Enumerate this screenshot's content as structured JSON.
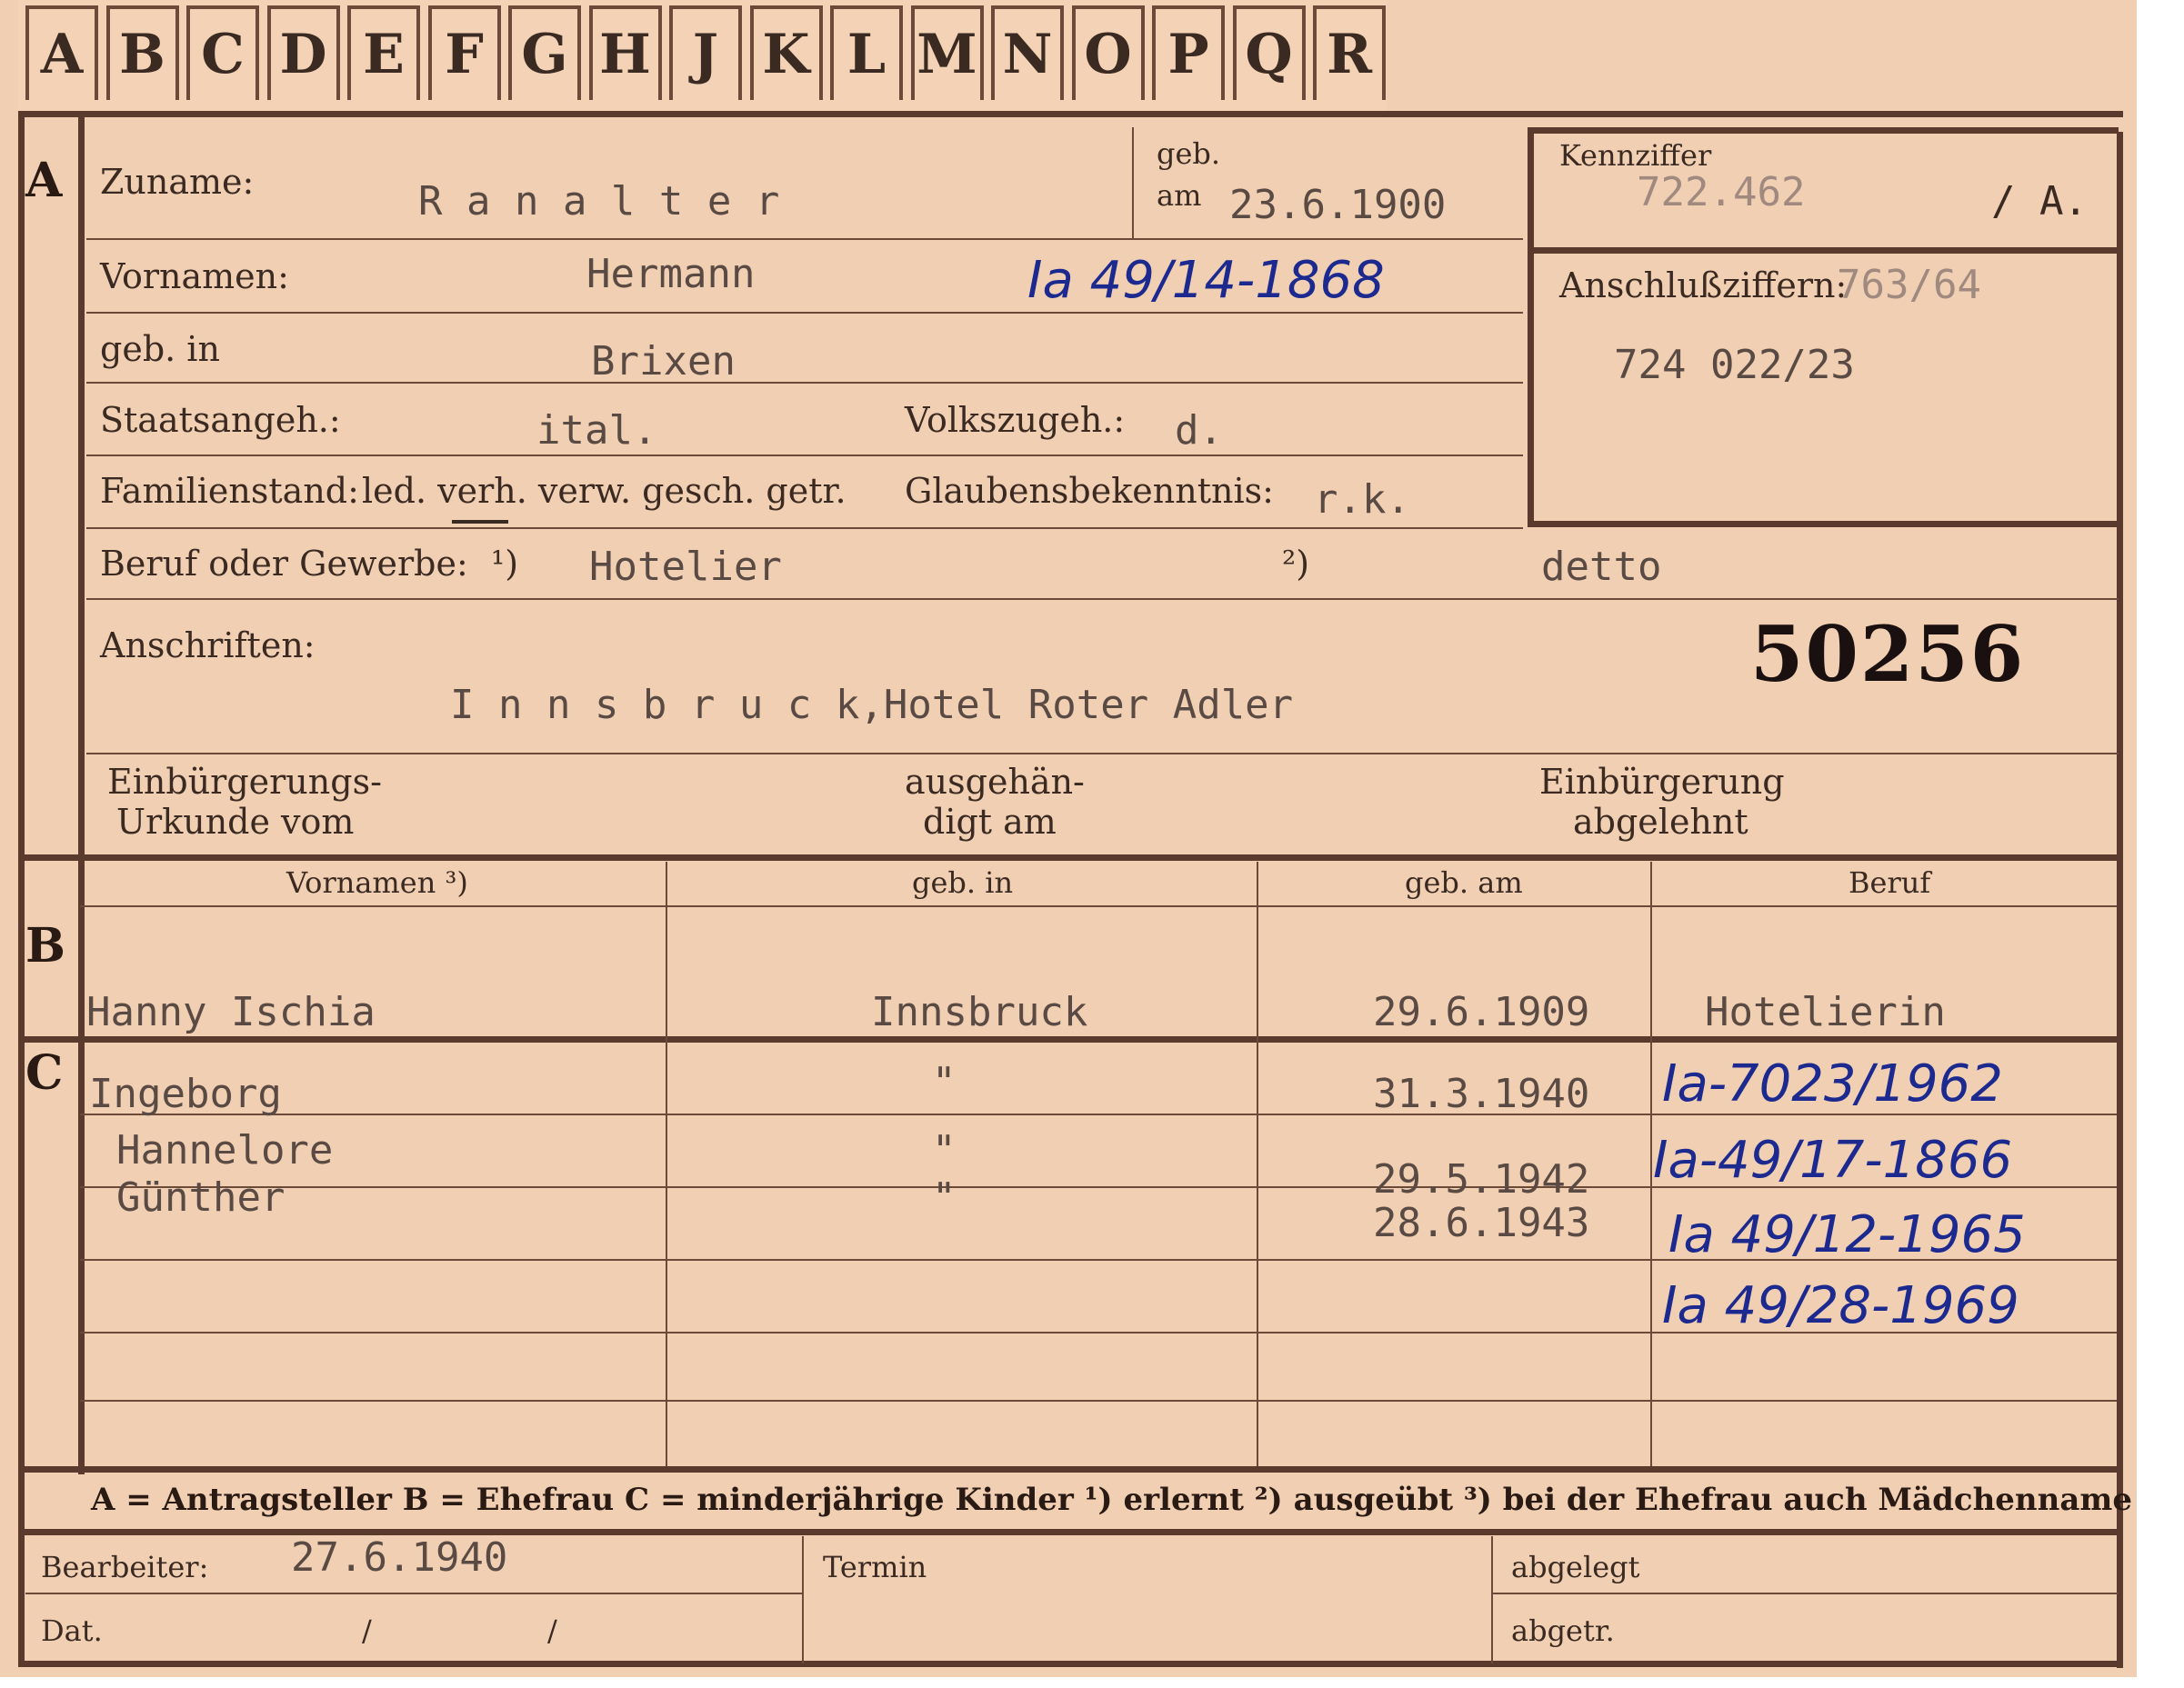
{
  "alphabet_tabs": [
    "A",
    "B",
    "C",
    "D",
    "E",
    "F",
    "G",
    "H",
    "J",
    "K",
    "L",
    "M",
    "N",
    "O",
    "P",
    "Q",
    "R"
  ],
  "sections": {
    "a": "A",
    "b": "B",
    "c": "C"
  },
  "fields": {
    "zuname_label": "Zuname:",
    "zuname_value": "R a n a l t e r",
    "geb_label": "geb.",
    "am_label": "am",
    "geb_am_value": "23.6.1900",
    "kennziffer_label": "Kennziffer",
    "kennziffer_value": "722.462",
    "kennziffer_suffix": "/ A.",
    "vornamen_label": "Vornamen:",
    "vornamen_value": "Hermann",
    "vornamen_hand": "Ia 49/14-1868",
    "anschluss_label": "Anschlußziffern:",
    "anschluss_value1": "763/64",
    "anschluss_value2": "724 022/23",
    "geb_in_label": "geb. in",
    "geb_in_value": "Brixen",
    "staats_label": "Staatsangeh.:",
    "staats_value": "ital.",
    "volks_label": "Volkszugeh.:",
    "volks_value": "d.",
    "familien_label": "Familienstand:",
    "familien_options": "led. verh. verw. gesch. getr.",
    "glaubens_label": "Glaubensbekenntnis:",
    "glaubens_value": "r.k.",
    "beruf_label": "Beruf oder Gewerbe:",
    "beruf_note1": "¹)",
    "beruf_value": "Hotelier",
    "beruf_note2": "²)",
    "beruf_value2": "detto",
    "anschriften_label": "Anschriften:",
    "anschriften_value": "I n n s b r u c k,Hotel Roter Adler",
    "big_number": "50256",
    "einb_label1": "Einbürgerungs-",
    "einb_label2": "Urkunde vom",
    "ausgeh_label1": "ausgehän-",
    "ausgeh_label2": "digt am",
    "abgelehnt_label1": "Einbürgerung",
    "abgelehnt_label2": "abgelehnt"
  },
  "table_headers": [
    "Vornamen ³)",
    "geb. in",
    "geb. am",
    "Beruf"
  ],
  "spouse": {
    "vornamen": "Hanny Ischia",
    "geb_in": "Innsbruck",
    "geb_am": "29.6.1909",
    "beruf": "Hotelierin"
  },
  "children": [
    {
      "vornamen": "Ingeborg",
      "geb_in": "\"",
      "geb_am": "31.3.1940",
      "hand": "Ia-7023/1962"
    },
    {
      "vornamen": "Hannelore",
      "geb_in": "\"",
      "geb_am": "29.5.1942",
      "hand": "Ia-49/17-1866"
    },
    {
      "vornamen": "Günther",
      "geb_in": "\"",
      "geb_am": "28.6.1943",
      "hand": "Ia 49/12-1965"
    },
    {
      "hand": "Ia 49/28-1969"
    }
  ],
  "legend": "A = Antragsteller   B = Ehefrau   C = minderjährige Kinder   ¹) erlernt   ²) ausgeübt   ³) bei der Ehefrau auch Mädchenname",
  "footer": {
    "bearbeiter_label": "Bearbeiter:",
    "bearbeiter_value": "27.6.1940",
    "dat_label": "Dat.",
    "dat_slash1": "/",
    "dat_slash2": "/",
    "termin_label": "Termin",
    "abgelegt_label": "abgelegt",
    "abgetr_label": "abgetr."
  }
}
